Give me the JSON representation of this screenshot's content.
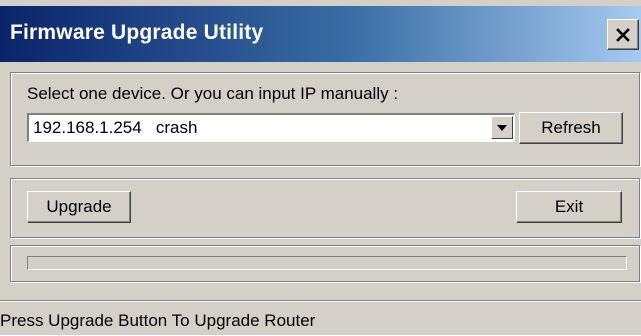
{
  "window": {
    "title": "Firmware Upgrade Utility",
    "close_glyph": "×"
  },
  "device_group": {
    "label": "Select one device. Or you can input IP manually :",
    "device_value": "192.168.1.254   crash",
    "refresh_label": "Refresh"
  },
  "actions": {
    "upgrade_label": "Upgrade",
    "exit_label": "Exit"
  },
  "progress": {
    "fraction": 0
  },
  "status": {
    "text": "Press Upgrade Button To Upgrade Router"
  },
  "colors": {
    "title_gradient_start": "#0a246a",
    "title_gradient_end": "#a6caf0",
    "face": "#d4d0c8"
  }
}
